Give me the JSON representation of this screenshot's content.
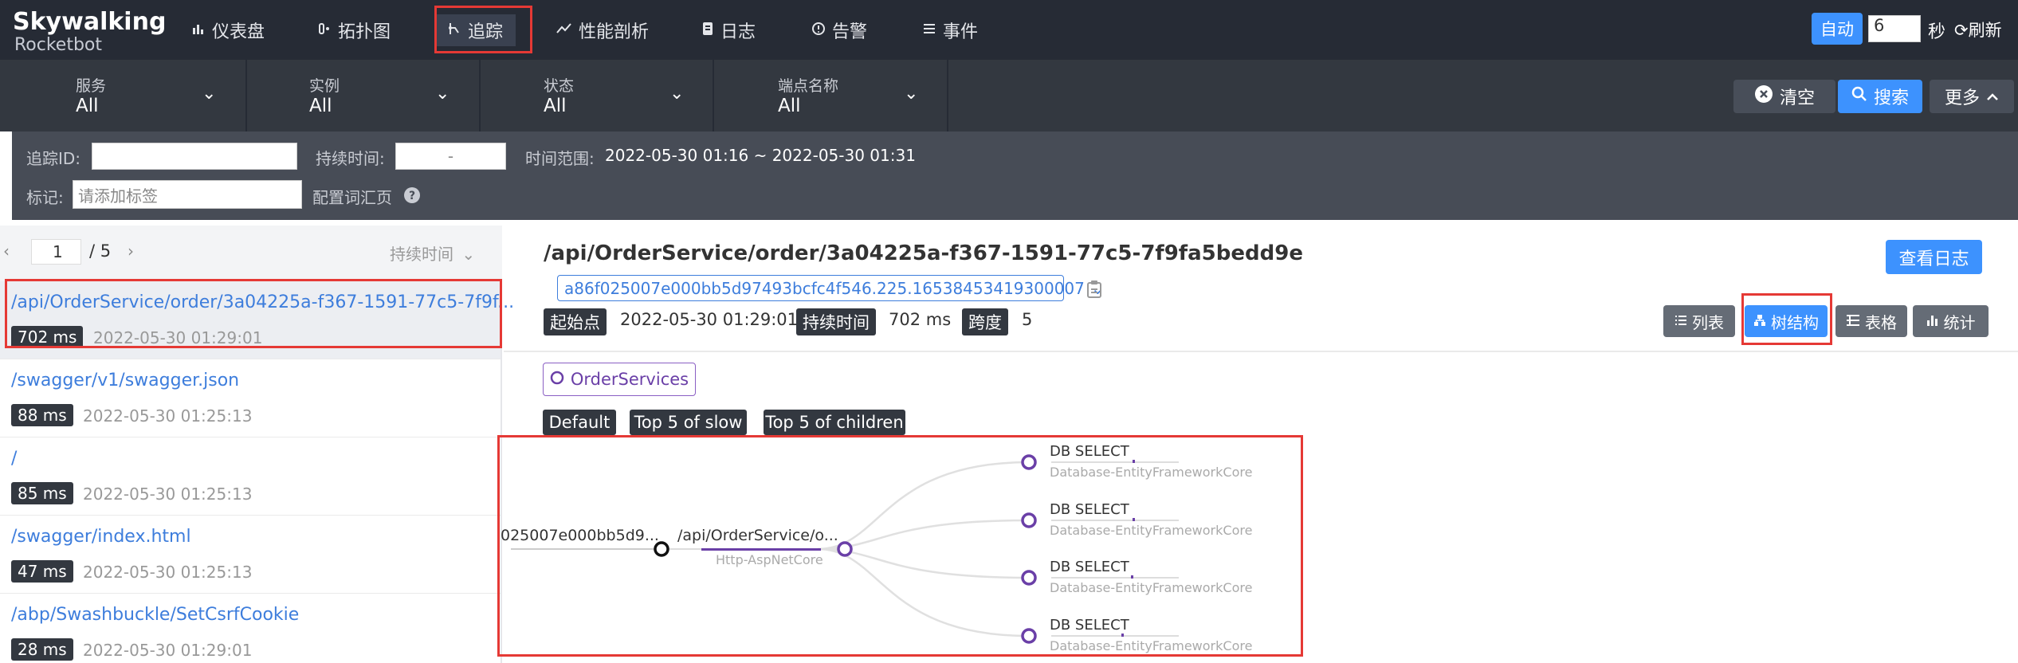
{
  "brand": {
    "name": "Skywalking",
    "sub": "Rocketbot"
  },
  "nav": [
    {
      "label": "仪表盘",
      "icon": "chart-icon"
    },
    {
      "label": "拓扑图",
      "icon": "topology-icon"
    },
    {
      "label": "追踪",
      "icon": "trace-icon"
    },
    {
      "label": "性能剖析",
      "icon": "profile-icon"
    },
    {
      "label": "日志",
      "icon": "log-icon"
    },
    {
      "label": "告警",
      "icon": "alarm-icon"
    },
    {
      "label": "事件",
      "icon": "event-icon"
    }
  ],
  "refresh": {
    "auto_label": "自动",
    "interval": "6",
    "unit": "秒",
    "refresh_label": "刷新"
  },
  "filters": [
    {
      "label": "服务",
      "value": "All"
    },
    {
      "label": "实例",
      "value": "All"
    },
    {
      "label": "状态",
      "value": "All"
    },
    {
      "label": "端点名称",
      "value": "All"
    }
  ],
  "actions": {
    "clear": "清空",
    "search": "搜索",
    "more": "更多"
  },
  "search": {
    "trace_id_label": "追踪ID:",
    "trace_id_value": "",
    "duration_label": "持续时间:",
    "duration_value": "-",
    "time_range_label": "时间范围:",
    "time_range_value": "2022-05-30 01:16 ~ 2022-05-30 01:31",
    "tag_label": "标记:",
    "tag_placeholder": "请添加标签",
    "config_label": "配置词汇页"
  },
  "pager": {
    "page": "1",
    "total": "/ 5",
    "sort_label": "持续时间"
  },
  "traces": [
    {
      "endpoint": "/api/OrderService/order/3a04225a-f367-1591-77c5-7f9f...",
      "duration": "702 ms",
      "time": "2022-05-30 01:29:01"
    },
    {
      "endpoint": "/swagger/v1/swagger.json",
      "duration": "88 ms",
      "time": "2022-05-30 01:25:13"
    },
    {
      "endpoint": "/",
      "duration": "85 ms",
      "time": "2022-05-30 01:25:13"
    },
    {
      "endpoint": "/swagger/index.html",
      "duration": "47 ms",
      "time": "2022-05-30 01:25:13"
    },
    {
      "endpoint": "/abp/Swashbuckle/SetCsrfCookie",
      "duration": "28 ms",
      "time": "2022-05-30 01:29:01"
    }
  ],
  "detail": {
    "title": "/api/OrderService/order/3a04225a-f367-1591-77c5-7f9fa5bedd9e",
    "trace_id": "a86f025007e000bb5d97493bcfc4f546.225.16538453419300007",
    "view_logs": "查看日志",
    "start_label": "起始点",
    "start_value": "2022-05-30 01:29:01",
    "duration_label": "持续时间",
    "duration_value": "702 ms",
    "span_label": "跨度",
    "span_value": "5",
    "views": [
      "列表",
      "树结构",
      "表格",
      "统计"
    ],
    "service": "OrderServices",
    "tree_modes": [
      "Default",
      "Top 5 of slow",
      "Top 5 of children"
    ]
  },
  "tree": {
    "root": {
      "label": "025007e000bb5d9..."
    },
    "entry": {
      "label": "/api/OrderService/o...",
      "component": "Http-AspNetCore"
    },
    "children": [
      {
        "label": "DB SELECT",
        "component": "Database-EntityFrameworkCore"
      },
      {
        "label": "DB SELECT",
        "component": "Database-EntityFrameworkCore"
      },
      {
        "label": "DB SELECT",
        "component": "Database-EntityFrameworkCore"
      },
      {
        "label": "DB SELECT",
        "component": "Database-EntityFrameworkCore"
      }
    ]
  },
  "colors": {
    "topbar": "#262b35",
    "accent": "#3d92fe",
    "link": "#3d7ddc",
    "highlight": "#e53935",
    "span_node": "#6a3fa7"
  }
}
